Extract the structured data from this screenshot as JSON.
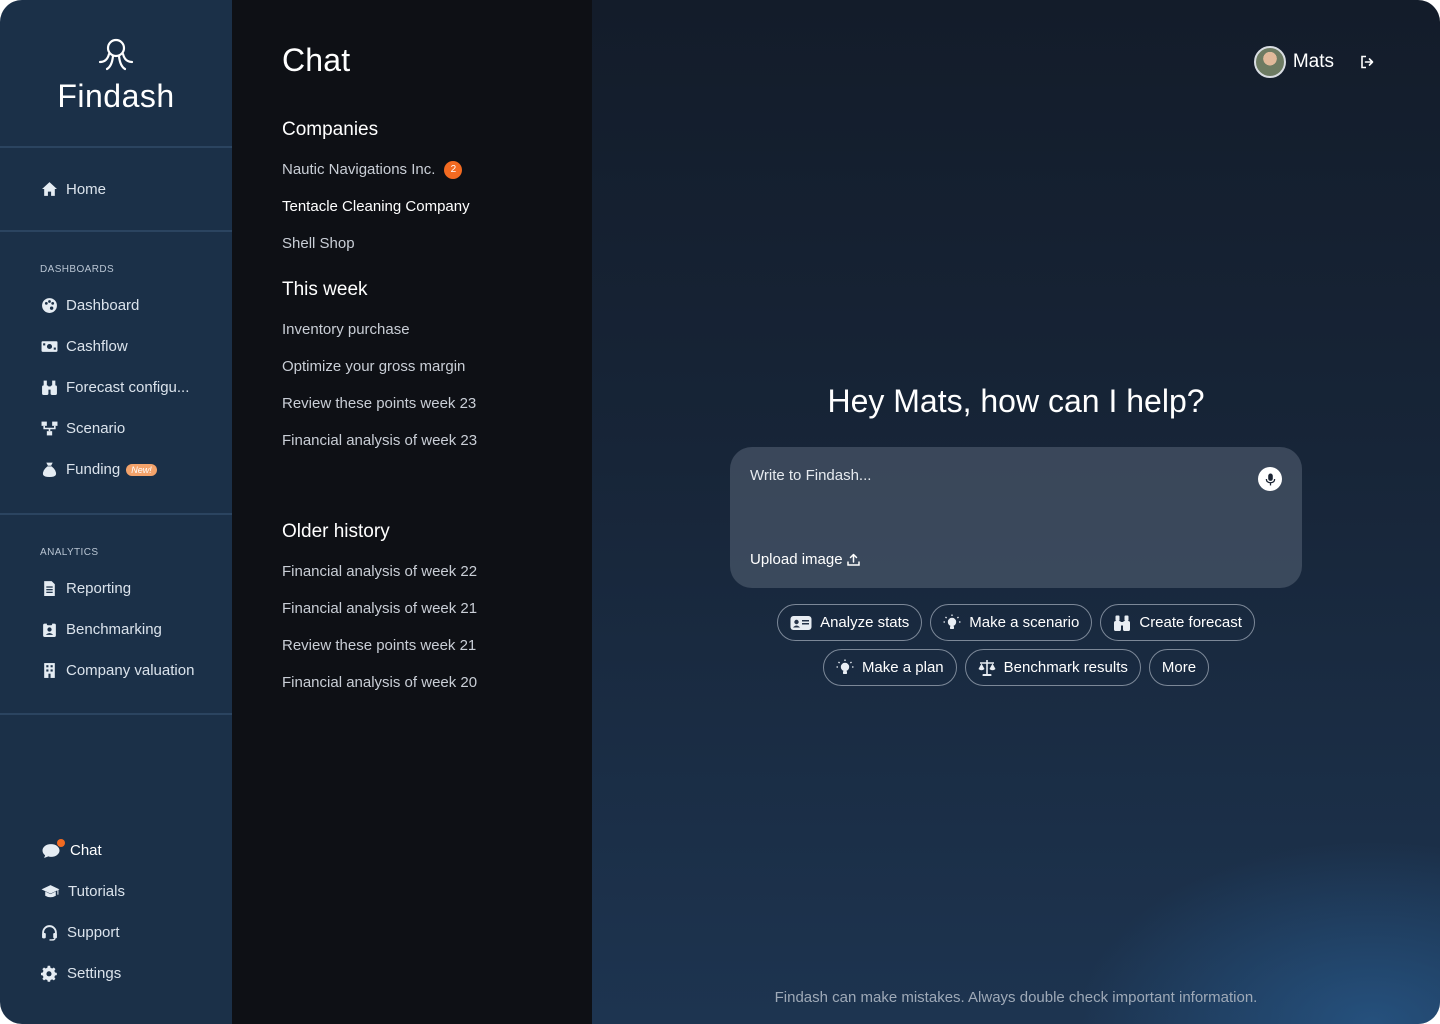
{
  "brand": {
    "name": "Findash"
  },
  "sidebar": {
    "home": {
      "label": "Home"
    },
    "dashboards": {
      "title": "DASHBOARDS",
      "items": [
        {
          "label": "Dashboard",
          "icon": "palette-icon"
        },
        {
          "label": "Cashflow",
          "icon": "money-bill-icon"
        },
        {
          "label": "Forecast configu...",
          "icon": "binoculars-icon"
        },
        {
          "label": "Scenario",
          "icon": "sitemap-icon"
        },
        {
          "label": "Funding",
          "icon": "money-bag-icon",
          "badge": "New!"
        }
      ]
    },
    "analytics": {
      "title": "ANALYTICS",
      "items": [
        {
          "label": "Reporting",
          "icon": "file-icon"
        },
        {
          "label": "Benchmarking",
          "icon": "clipboard-icon"
        },
        {
          "label": "Company valuation",
          "icon": "building-icon"
        }
      ]
    },
    "bottom": [
      {
        "label": "Chat",
        "icon": "chat-icon"
      },
      {
        "label": "Tutorials",
        "icon": "graduation-cap-icon"
      },
      {
        "label": "Support",
        "icon": "headset-icon"
      },
      {
        "label": "Settings",
        "icon": "gear-icon"
      }
    ]
  },
  "history": {
    "title": "Chat",
    "companies": {
      "title": "Companies",
      "items": [
        {
          "label": "Nautic Navigations Inc.",
          "count": "2"
        },
        {
          "label": "Tentacle Cleaning Company"
        },
        {
          "label": "Shell Shop"
        }
      ]
    },
    "this_week": {
      "title": "This week",
      "items": [
        "Inventory purchase",
        "Optimize your gross margin",
        "Review these points week 23",
        "Financial analysis of week 23"
      ]
    },
    "older": {
      "title": "Older history",
      "items": [
        "Financial analysis of week 22",
        "Financial analysis of week 21",
        "Review these points week 21",
        "Financial analysis of week 20"
      ]
    }
  },
  "user": {
    "name": "Mats"
  },
  "main": {
    "greeting": "Hey Mats, how can I help?",
    "composer_placeholder": "Write to Findash...",
    "upload_label": "Upload image",
    "chips_row1": [
      "Analyze stats",
      "Make a scenario",
      "Create forecast"
    ],
    "chips_row2": [
      "Make a plan",
      "Benchmark results",
      "More"
    ],
    "disclaimer": "Findash can make mistakes. Always double check important information."
  },
  "colors": {
    "sidebar_bg": "#1b3048",
    "history_bg": "#0e1015",
    "accent_orange": "#f26a21",
    "badge_new": "#f4a36b"
  }
}
